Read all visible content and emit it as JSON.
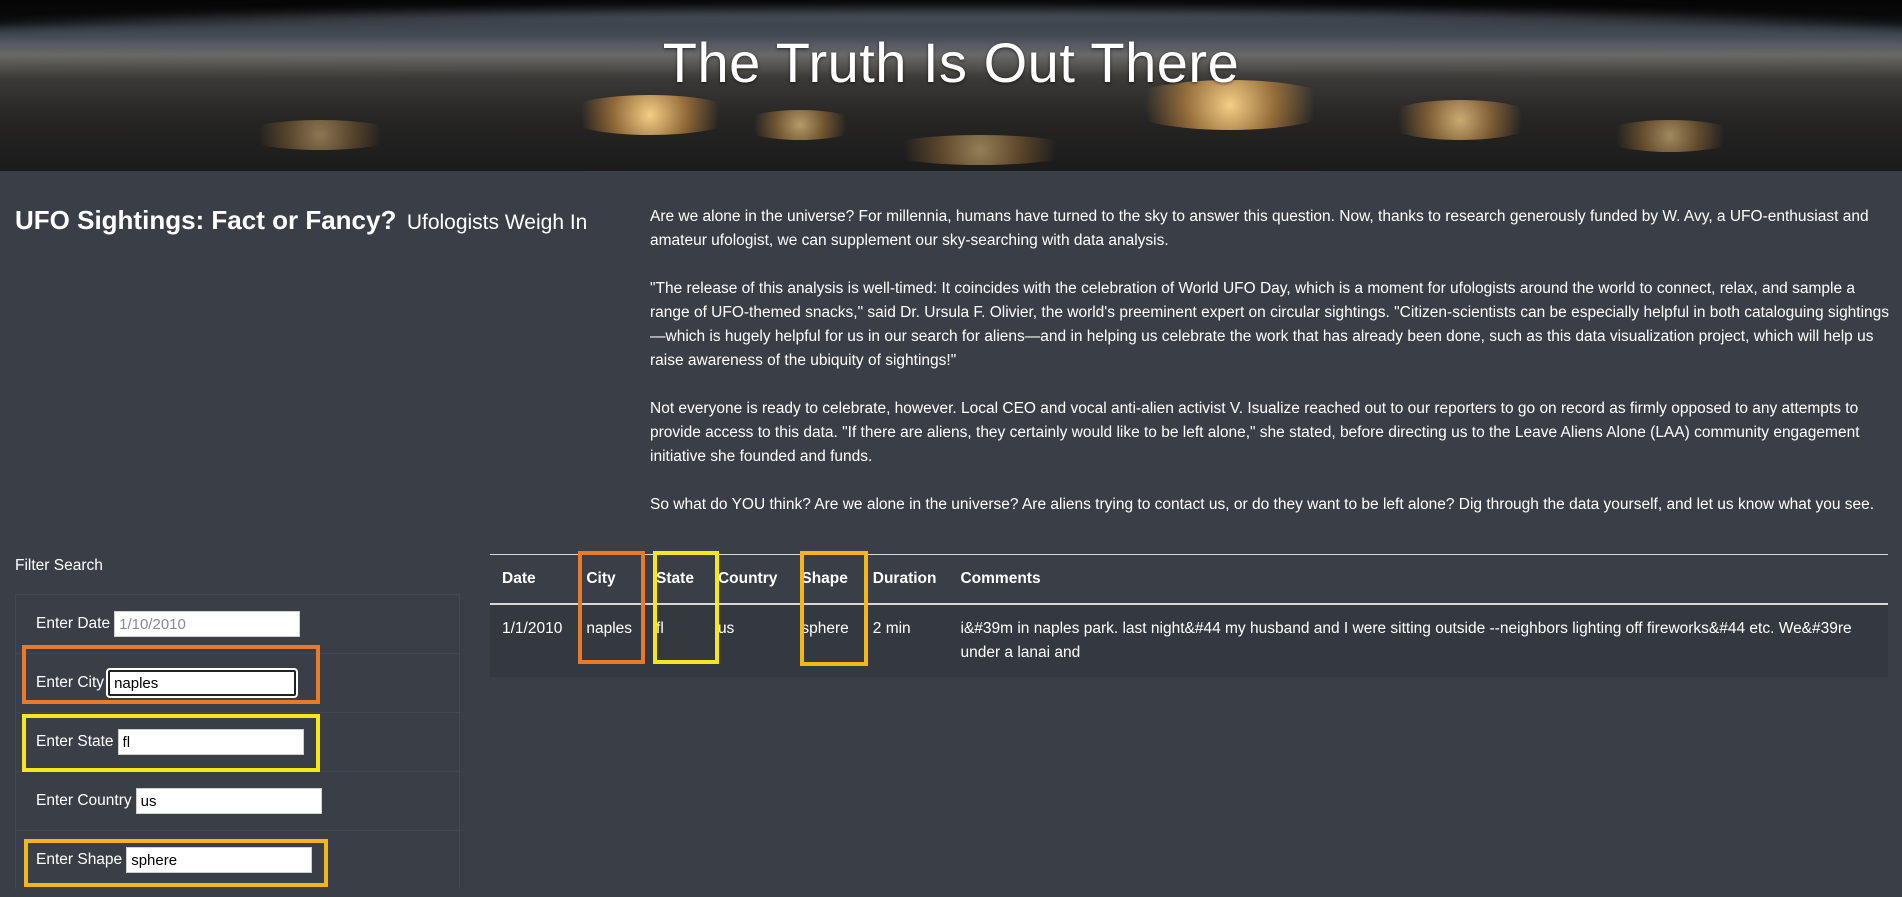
{
  "hero": {
    "title": "The Truth Is Out There"
  },
  "heading": {
    "main": "UFO Sightings: Fact or Fancy?",
    "sub": "Ufologists Weigh In"
  },
  "article": {
    "paragraphs": [
      "Are we alone in the universe? For millennia, humans have turned to the sky to answer this question. Now, thanks to research generously funded by W. Avy, a UFO-enthusiast and amateur ufologist, we can supplement our sky-searching with data analysis.",
      "\"The release of this analysis is well-timed: It coincides with the celebration of World UFO Day, which is a moment for ufologists around the world to connect, relax, and sample a range of UFO-themed snacks,\" said Dr. Ursula F. Olivier, the world's preeminent expert on circular sightings. \"Citizen-scientists can be especially helpful in both cataloguing sightings—which is hugely helpful for us in our search for aliens—and in helping us celebrate the work that has already been done, such as this data visualization project, which will help us raise awareness of the ubiquity of sightings!\"",
      "Not everyone is ready to celebrate, however. Local CEO and vocal anti-alien activist V. Isualize reached out to our reporters to go on record as firmly opposed to any attempts to provide access to this data. \"If there are aliens, they certainly would like to be left alone,\" she stated, before directing us to the Leave Aliens Alone (LAA) community engagement initiative she founded and funds.",
      "So what do YOU think? Are we alone in the universe? Are aliens trying to contact us, or do they want to be left alone? Dig through the data yourself, and let us know what you see."
    ]
  },
  "filters": {
    "title": "Filter Search",
    "date": {
      "label": "Enter Date",
      "value": "",
      "placeholder": "1/10/2010"
    },
    "city": {
      "label": "Enter City",
      "value": "naples",
      "placeholder": ""
    },
    "state": {
      "label": "Enter State",
      "value": "fl",
      "placeholder": ""
    },
    "country": {
      "label": "Enter Country",
      "value": "us",
      "placeholder": ""
    },
    "shape": {
      "label": "Enter Shape",
      "value": "sphere",
      "placeholder": ""
    }
  },
  "table": {
    "headers": [
      "Date",
      "City",
      "State",
      "Country",
      "Shape",
      "Duration",
      "Comments"
    ],
    "rows": [
      [
        "1/1/2010",
        "naples",
        "fl",
        "us",
        "sphere",
        "2 min",
        "i&#39m in naples park. last night&#44 my husband and I were sitting outside --neighbors lighting off fireworks&#44 etc. We&#39re under a lanai and"
      ]
    ]
  },
  "highlight_colors": {
    "orange": "#e87a2c",
    "yellow": "#f6e61b",
    "amber": "#f4b71a"
  }
}
